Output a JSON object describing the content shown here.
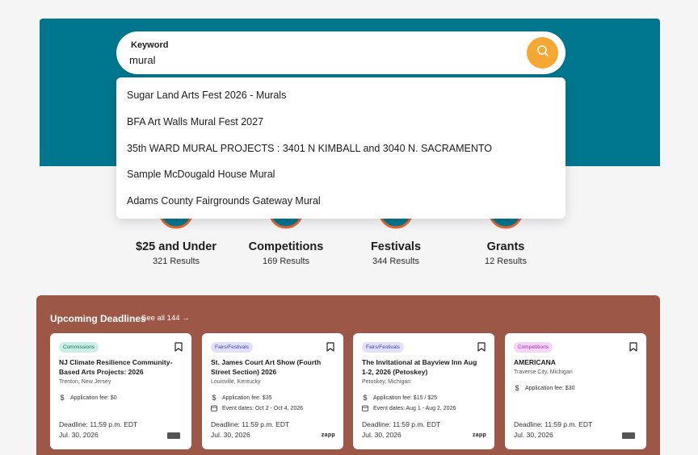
{
  "search": {
    "label": "Keyword",
    "value": "mural",
    "icon": "search-icon",
    "button_color": "#f5a733"
  },
  "suggestions": [
    "Sugar Land Arts Fest 2026 - Murals",
    "BFA Art Walls Mural Fest 2027",
    "35th WARD MURAL PROJECTS : 3401 N KIMBALL and 3040 N. SACRAMENTO",
    "Sample McDougald House Mural",
    "Adams County Fairgrounds Gateway Mural"
  ],
  "categories": [
    {
      "title": "$25 and Under",
      "count": "321 Results"
    },
    {
      "title": "Competitions",
      "count": "169 Results"
    },
    {
      "title": "Festivals",
      "count": "344 Results"
    },
    {
      "title": "Grants",
      "count": "12 Results"
    }
  ],
  "deadlines": {
    "title": "Upcoming Deadlines",
    "see_all": "See all 144 →",
    "cards": [
      {
        "badge": "Commissions",
        "title": "NJ Climate Resilience Community-Based Arts Projects: 2026",
        "location": "Trenton, New Jersey",
        "fee": "Application fee: $0",
        "event_dates": "",
        "deadline_time": "Deadline: 11:59 p.m. EDT",
        "deadline_date": "Jul. 30, 2026",
        "source": ""
      },
      {
        "badge": "Fairs/Festivals",
        "title": "St. James Court Art Show (Fourth Street Section) 2026",
        "location": "Louisville, Kentucky",
        "fee": "Application fee: $35",
        "event_dates": "Event dates: Oct 2 - Oct 4, 2026",
        "deadline_time": "Deadline: 11:59 p.m. EDT",
        "deadline_date": "Jul. 30, 2026",
        "source": "zapp"
      },
      {
        "badge": "Fairs/Festivals",
        "title": "The Invitational at Bayview Inn Aug 1-2, 2026 (Petoskey)",
        "location": "Petoskey, Michigan",
        "fee": "Application fee: $15 / $25",
        "event_dates": "Event dates: Aug 1 - Aug 2, 2026",
        "deadline_time": "Deadline: 11:59 p.m. EDT",
        "deadline_date": "Jul. 30, 2026",
        "source": "zapp"
      },
      {
        "badge": "Competitions",
        "title": "AMERICANA",
        "location": "Traverse City, Michigan",
        "fee": "Application fee: $30",
        "event_dates": "",
        "deadline_time": "Deadline: 11:59 p.m. EDT",
        "deadline_date": "Jul. 30, 2026",
        "source": ""
      }
    ]
  },
  "colors": {
    "hero": "#00778f",
    "deadlines_bg": "#9d5746",
    "badge_commissions": "#c9f0e6",
    "badge_fairs": "#e0e0fb",
    "badge_competitions": "#f6d4f7"
  }
}
